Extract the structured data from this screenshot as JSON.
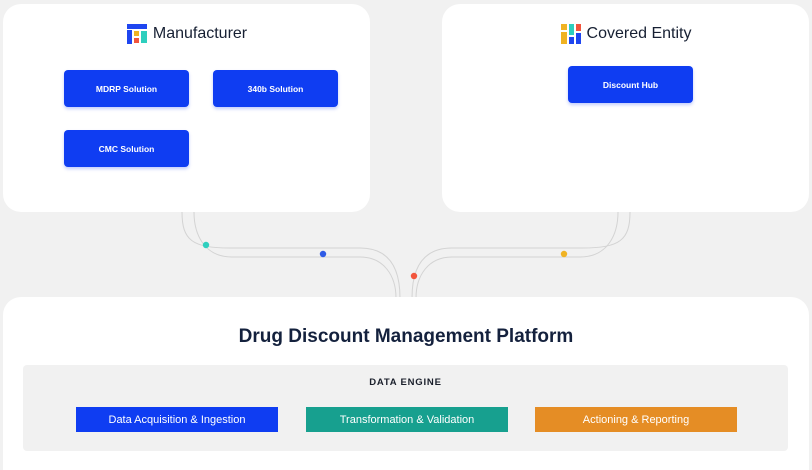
{
  "manufacturer": {
    "title": "Manufacturer",
    "logo_icon": "manufacturer-logo-icon",
    "buttons": [
      {
        "label": "MDRP Solution"
      },
      {
        "label": "340b Solution"
      },
      {
        "label": "CMC Solution"
      }
    ]
  },
  "covered_entity": {
    "title": "Covered Entity",
    "logo_icon": "covered-entity-logo-icon",
    "buttons": [
      {
        "label": "Discount Hub"
      }
    ]
  },
  "platform": {
    "title": "Drug Discount Management Platform",
    "data_engine": {
      "title": "DATA ENGINE",
      "stages": [
        {
          "label": "Data Acquisition & Ingestion",
          "color": "#0f3df2"
        },
        {
          "label": "Transformation & Validation",
          "color": "#17a08f"
        },
        {
          "label": "Actioning & Reporting",
          "color": "#e58d25"
        }
      ]
    }
  },
  "colors": {
    "primary_blue": "#0f3df2",
    "teal": "#2ecfbe",
    "dot_blue": "#2f5be6",
    "dot_red": "#f2553d",
    "dot_yellow": "#f0b323",
    "background": "#f1f1f1"
  }
}
